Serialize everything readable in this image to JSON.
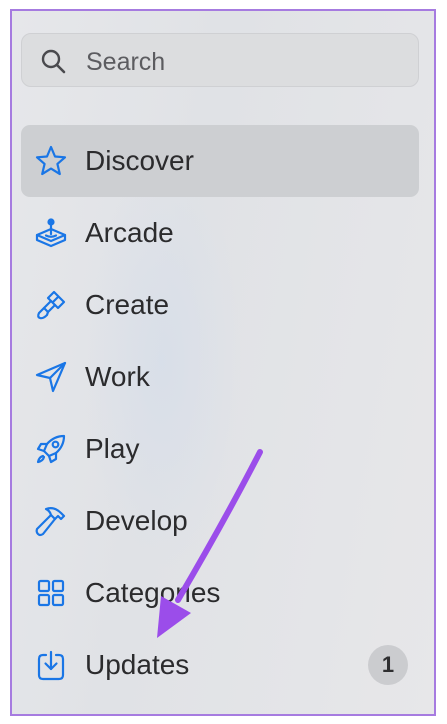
{
  "search": {
    "placeholder": "Search",
    "icon": "magnifying-glass-icon"
  },
  "sidebar": {
    "items": [
      {
        "label": "Discover",
        "icon": "star-icon",
        "selected": true
      },
      {
        "label": "Arcade",
        "icon": "joystick-icon",
        "selected": false
      },
      {
        "label": "Create",
        "icon": "paintbrush-icon",
        "selected": false
      },
      {
        "label": "Work",
        "icon": "paperplane-icon",
        "selected": false
      },
      {
        "label": "Play",
        "icon": "rocket-icon",
        "selected": false
      },
      {
        "label": "Develop",
        "icon": "hammer-icon",
        "selected": false
      },
      {
        "label": "Categories",
        "icon": "grid-icon",
        "selected": false
      },
      {
        "label": "Updates",
        "icon": "download-icon",
        "selected": false,
        "badge": "1"
      }
    ]
  },
  "colors": {
    "accent": "#1a76e6",
    "selected_bg": "#cdcfd2",
    "sidebar_bg": "#e4e5e8",
    "annotation": "#9b4dea",
    "frame_border": "#a67be0"
  }
}
